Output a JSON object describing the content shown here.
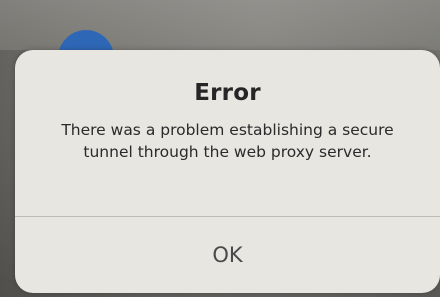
{
  "alert": {
    "title": "Error",
    "message": "There was a problem establishing a secure tunnel through the web proxy server.",
    "ok_label": "OK"
  },
  "colors": {
    "background_app_icon": "#2f67b7",
    "dialog_background": "#e8e6e1"
  }
}
